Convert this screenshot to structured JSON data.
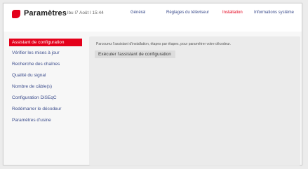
{
  "header": {
    "title": "Paramètres",
    "datetime": "lbu l7 Août l 15:44"
  },
  "tabs": [
    {
      "label": "Général",
      "active": false
    },
    {
      "label": "Réglages du téléviseur",
      "active": false
    },
    {
      "label": "Installation",
      "active": true
    },
    {
      "label": "Informations système",
      "active": false
    }
  ],
  "sidebar": {
    "items": [
      {
        "label": "Assistant de configuration",
        "selected": true
      },
      {
        "label": "Vérifier les mises à jour",
        "selected": false
      },
      {
        "label": "Recherche des chaînes",
        "selected": false
      },
      {
        "label": "Qualité du signal",
        "selected": false
      },
      {
        "label": "Nombre de câble(s)",
        "selected": false
      },
      {
        "label": "Configuration DiSEqC",
        "selected": false
      },
      {
        "label": "Redémarrer le décodeur",
        "selected": false
      },
      {
        "label": "Paramètres d'usine",
        "selected": false
      }
    ]
  },
  "content": {
    "description": "Parcourez l'assistant d'installation, étapes par étapes, pour paramétrer votre décodeur.",
    "run_button": "Exécuter l'assistant de configuration"
  },
  "colors": {
    "accent": "#e4001b",
    "link": "#3b4c8c"
  }
}
